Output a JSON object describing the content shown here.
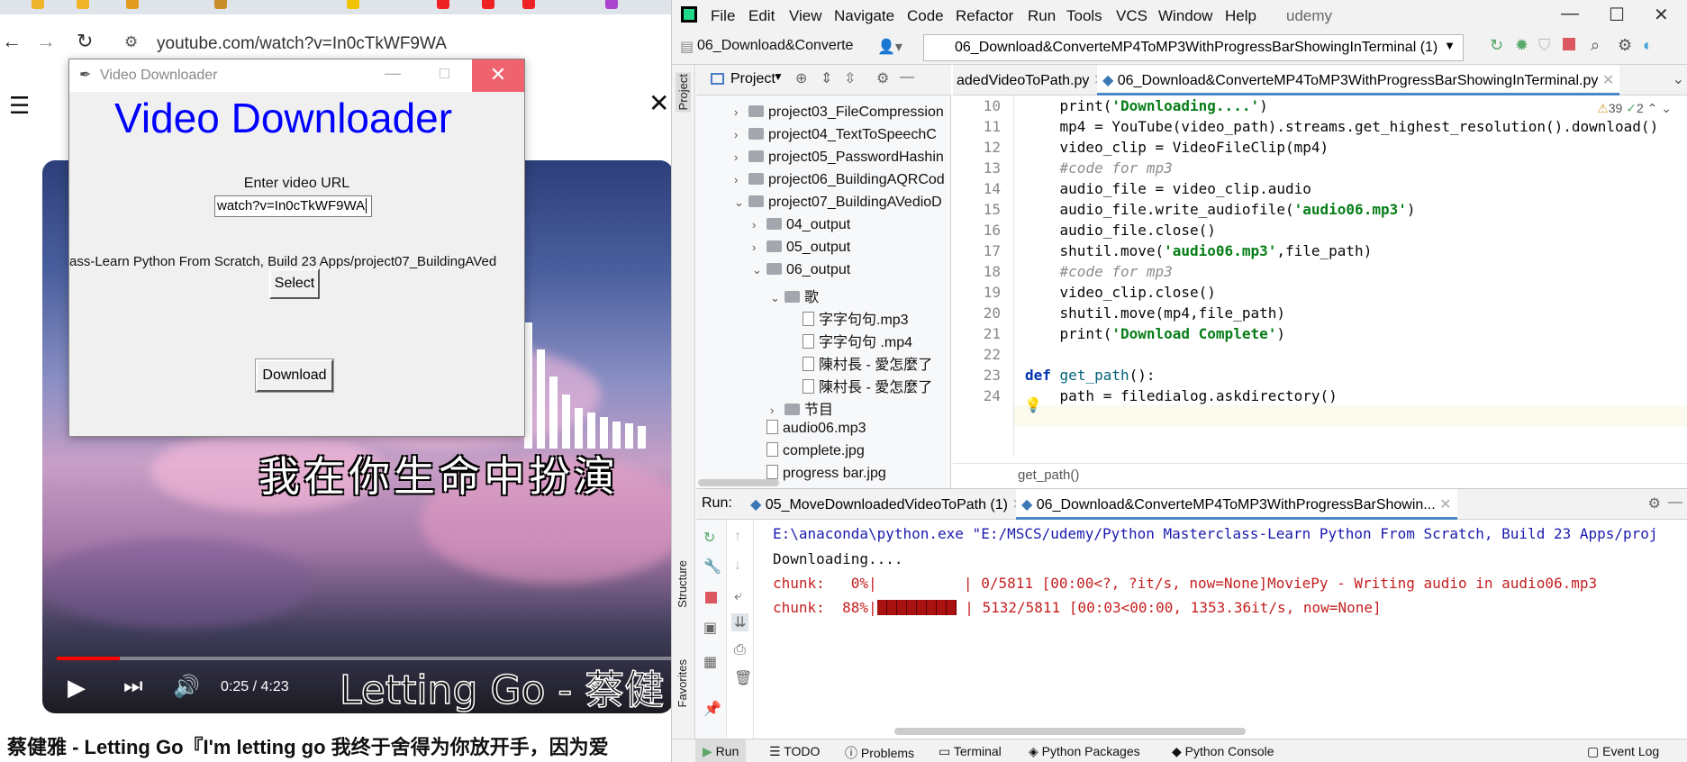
{
  "browser": {
    "url": "youtube.com/watch?v=In0cTkWF9WA",
    "video": {
      "subtitle_top": "我在你生命中扮演",
      "subtitle_bottom": "Letting Go - 蔡健",
      "time": "0:25 / 4:23",
      "progress_fraction": 0.1
    },
    "video_title": "蔡健雅 - Letting Go『I'm letting go 我终于舍得为你放开手，因为爱"
  },
  "tk_window": {
    "title": "Video Downloader",
    "heading": "Video Downloader",
    "label": "Enter video URL",
    "input_value": "watch?v=In0cTkWF9WA",
    "path_text": "ass-Learn Python From Scratch, Build 23 Apps/project07_BuildingAVed",
    "select_label": "Select",
    "download_label": "Download"
  },
  "ide": {
    "menu": [
      "File",
      "Edit",
      "View",
      "Navigate",
      "Code",
      "Refactor",
      "Run",
      "Tools",
      "VCS",
      "Window",
      "Help"
    ],
    "project_name": "udemy",
    "breadcrumb_project": "06_Download&Converte",
    "run_config": "06_Download&ConverteMP4ToMP3WithProgressBarShowingInTerminal (1)",
    "project_panel_title": "Project",
    "tree": [
      {
        "label": "project03_FileCompression",
        "type": "folder",
        "indent": 0,
        "chev": ">"
      },
      {
        "label": "project04_TextToSpeechC",
        "type": "folder",
        "indent": 0,
        "chev": ">"
      },
      {
        "label": "project05_PasswordHashin",
        "type": "folder",
        "indent": 0,
        "chev": ">"
      },
      {
        "label": "project06_BuildingAQRCod",
        "type": "folder",
        "indent": 0,
        "chev": ">"
      },
      {
        "label": "project07_BuildingAVedioD",
        "type": "folder",
        "indent": 0,
        "chev": "v"
      },
      {
        "label": "04_output",
        "type": "folder",
        "indent": 1,
        "chev": ">"
      },
      {
        "label": "05_output",
        "type": "folder",
        "indent": 1,
        "chev": ">"
      },
      {
        "label": "06_output",
        "type": "folder",
        "indent": 1,
        "chev": "v"
      },
      {
        "label": "歌",
        "type": "folder",
        "indent": 2,
        "chev": "v"
      },
      {
        "label": "字字句句.mp3",
        "type": "file",
        "indent": 3,
        "chev": ""
      },
      {
        "label": "字字句句 .mp4",
        "type": "file",
        "indent": 3,
        "chev": ""
      },
      {
        "label": "陳村長 - 愛怎麼了",
        "type": "file",
        "indent": 3,
        "chev": ""
      },
      {
        "label": "陳村長 - 愛怎麼了",
        "type": "file",
        "indent": 3,
        "chev": ""
      },
      {
        "label": "节目",
        "type": "folder",
        "indent": 2,
        "chev": ">"
      },
      {
        "label": "audio06.mp3",
        "type": "file",
        "indent": 1,
        "chev": ""
      },
      {
        "label": "complete.jpg",
        "type": "file",
        "indent": 1,
        "chev": ""
      },
      {
        "label": "progress bar.jpg",
        "type": "file",
        "indent": 1,
        "chev": ""
      }
    ],
    "editor_tabs": [
      "adedVideoToPath.py",
      "06_Download&ConverteMP4ToMP3WithProgressBarShowingInTerminal.py"
    ],
    "inspections": {
      "warnings": "39",
      "ok": "2"
    },
    "code_lines": [
      {
        "n": "10",
        "html": "    print(<span class=\"str\">'Downloading....'</span>)"
      },
      {
        "n": "11",
        "html": "    mp4 = YouTube(video_path).streams.get_highest_resolution().download()"
      },
      {
        "n": "12",
        "html": "    video_clip = VideoFileClip(mp4)"
      },
      {
        "n": "13",
        "html": "    <span class=\"cm\">#code for mp3</span>"
      },
      {
        "n": "14",
        "html": "    audio_file = video_clip.audio"
      },
      {
        "n": "15",
        "html": "    audio_file.write_audiofile(<span class=\"str\">'audio06.mp3'</span>)"
      },
      {
        "n": "16",
        "html": "    audio_file.close()"
      },
      {
        "n": "17",
        "html": "    shutil.move(<span class=\"str\">'audio06.mp3'</span>,file_path)"
      },
      {
        "n": "18",
        "html": "    <span class=\"cm\">#code for mp3</span>"
      },
      {
        "n": "19",
        "html": "    video_clip.close()"
      },
      {
        "n": "20",
        "html": "    shutil.move(mp4,file_path)"
      },
      {
        "n": "21",
        "html": "    print(<span class=\"str\">'Download Complete'</span>)"
      },
      {
        "n": "22",
        "html": ""
      },
      {
        "n": "23",
        "html": "<span class=\"kw\">def</span> <span class=\"fn\">get_path</span>():"
      },
      {
        "n": "24",
        "html": "    path = filedialog.askdirectory()"
      }
    ],
    "editor_breadcrumb": "get_path()",
    "run": {
      "label": "Run:",
      "tabs": [
        "05_MoveDownloadedVideoToPath (1)",
        "06_Download&ConverteMP4ToMP3WithProgressBarShowin..."
      ],
      "line1": "E:\\anaconda\\python.exe \"E:/MSCS/udemy/Python Masterclass-Learn Python From Scratch, Build 23 Apps/proj",
      "line2": "Downloading....",
      "line3": "chunk:   0%|          | 0/5811 [00:00<?, ?it/s, now=None]MoviePy - Writing audio in audio06.mp3",
      "line4_a": "chunk:  88%|",
      "line4_b": " | 5132/5811 [00:03<00:00, 1353.36it/s, now=None]",
      "progress_fraction": 0.88
    },
    "sidebar_tabs": {
      "project": "Project",
      "structure": "Structure",
      "favorites": "Favorites"
    },
    "status": {
      "run": "Run",
      "todo": "TODO",
      "problems": "Problems",
      "terminal": "Terminal",
      "packages": "Python Packages",
      "console": "Python Console",
      "event_log": "Event Log"
    }
  }
}
